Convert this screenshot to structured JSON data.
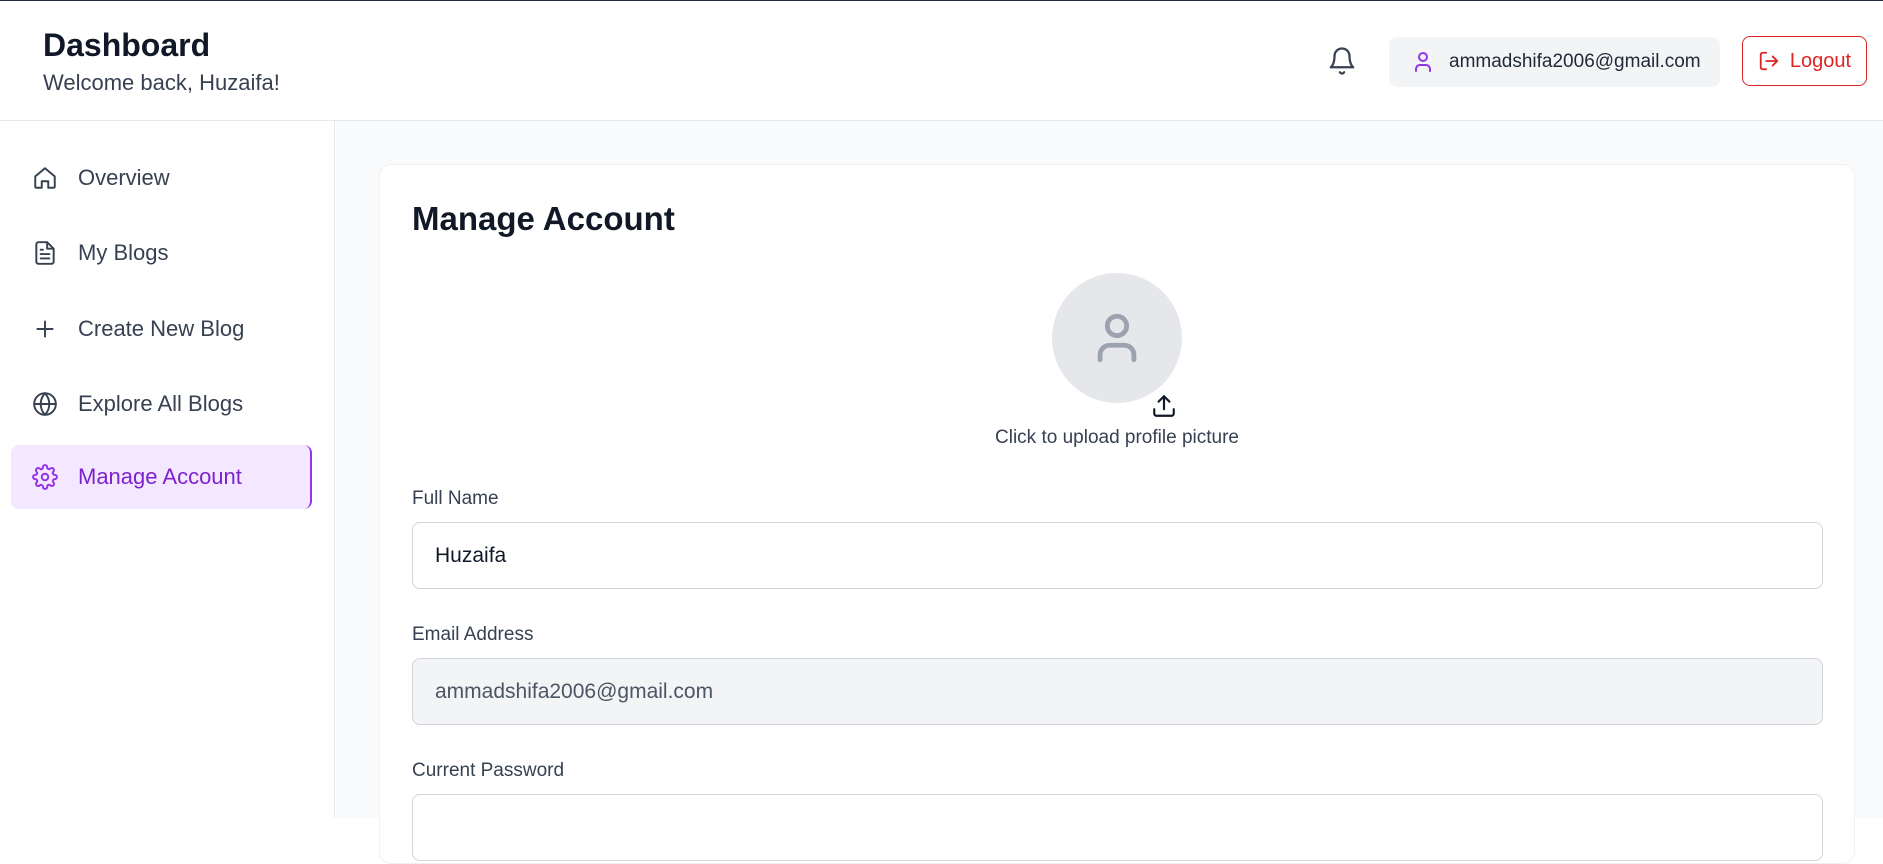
{
  "header": {
    "title": "Dashboard",
    "subtitle": "Welcome back, Huzaifa!",
    "user_email": "ammadshifa2006@gmail.com",
    "logout_label": "Logout"
  },
  "sidebar": {
    "items": [
      {
        "label": "Overview",
        "icon": "home-icon"
      },
      {
        "label": "My Blogs",
        "icon": "document-icon"
      },
      {
        "label": "Create New Blog",
        "icon": "plus-icon"
      },
      {
        "label": "Explore All Blogs",
        "icon": "globe-icon"
      },
      {
        "label": "Manage Account",
        "icon": "gear-icon",
        "active": true
      }
    ]
  },
  "account": {
    "title": "Manage Account",
    "upload_text": "Click to upload profile picture",
    "full_name_label": "Full Name",
    "full_name_value": "Huzaifa",
    "email_label": "Email Address",
    "email_value": "ammadshifa2006@gmail.com",
    "current_password_label": "Current Password"
  },
  "colors": {
    "accent": "#9333ea",
    "accent_bg": "#f3e8ff",
    "danger": "#dc2626"
  }
}
